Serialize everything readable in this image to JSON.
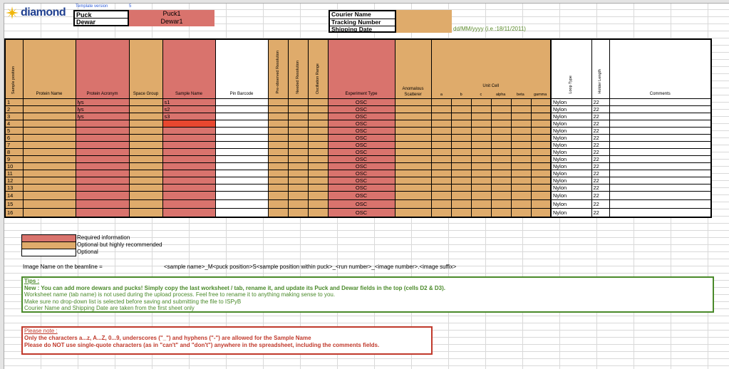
{
  "header": {
    "logo_text": "diamond",
    "template_version_label": "Template version",
    "template_version_value": "5",
    "puck_label": "Puck",
    "dewar_label": "Dewar",
    "puck_value": "Puck1",
    "dewar_value": "Dewar1",
    "courier_name_label": "Courier Name",
    "tracking_number_label": "Tracking Number",
    "shipping_date_label": "Shipping Date",
    "date_hint": "dd/MM/yyyy (i.e.:18/11/2011)"
  },
  "table": {
    "headers": {
      "sample_position": "Sample position",
      "protein_name": "Protein Name",
      "protein_acronym": "Protein Acronym",
      "space_group": "Space Group",
      "sample_name": "Sample Name",
      "pin_barcode": "Pin Barcode",
      "pre_observed_resolution": "Pre-observed Resolution",
      "needed_resolution": "Needed Resolution",
      "oscillation_range": "Oscillation Range",
      "experiment_type": "Experiment Type",
      "anomalous_scatterer": "Anomalous Scatterer",
      "unit_cell": "Unit Cell",
      "uc_a": "a",
      "uc_b": "b",
      "uc_c": "c",
      "uc_alpha": "alpha",
      "uc_beta": "beta",
      "uc_gamma": "gamma",
      "loop_type": "Loop Type",
      "holder_length": "Holder Length",
      "comments": "Comments"
    },
    "rows": [
      {
        "pos": "1",
        "acronym": "lys",
        "sample": "s1",
        "exp": "OSC",
        "loop": "Nylon",
        "holder": "22"
      },
      {
        "pos": "2",
        "acronym": "lys",
        "sample": "s2",
        "exp": "OSC",
        "loop": "Nylon",
        "holder": "22"
      },
      {
        "pos": "3",
        "acronym": "lys",
        "sample": "s3",
        "exp": "OSC",
        "loop": "Nylon",
        "holder": "22"
      },
      {
        "pos": "4",
        "acronym": "",
        "sample": "",
        "exp": "OSC",
        "loop": "Nylon",
        "holder": "22"
      },
      {
        "pos": "5",
        "acronym": "",
        "sample": "",
        "exp": "OSC",
        "loop": "Nylon",
        "holder": "22"
      },
      {
        "pos": "6",
        "acronym": "",
        "sample": "",
        "exp": "OSC",
        "loop": "Nylon",
        "holder": "22"
      },
      {
        "pos": "7",
        "acronym": "",
        "sample": "",
        "exp": "OSC",
        "loop": "Nylon",
        "holder": "22"
      },
      {
        "pos": "8",
        "acronym": "",
        "sample": "",
        "exp": "OSC",
        "loop": "Nylon",
        "holder": "22"
      },
      {
        "pos": "9",
        "acronym": "",
        "sample": "",
        "exp": "OSC",
        "loop": "Nylon",
        "holder": "22"
      },
      {
        "pos": "10",
        "acronym": "",
        "sample": "",
        "exp": "OSC",
        "loop": "Nylon",
        "holder": "22"
      },
      {
        "pos": "11",
        "acronym": "",
        "sample": "",
        "exp": "OSC",
        "loop": "Nylon",
        "holder": "22"
      },
      {
        "pos": "12",
        "acronym": "",
        "sample": "",
        "exp": "OSC",
        "loop": "Nylon",
        "holder": "22"
      },
      {
        "pos": "13",
        "acronym": "",
        "sample": "",
        "exp": "OSC",
        "loop": "Nylon",
        "holder": "22"
      },
      {
        "pos": "14",
        "acronym": "",
        "sample": "",
        "exp": "OSC",
        "loop": "Nylon",
        "holder": "22"
      },
      {
        "pos": "15",
        "acronym": "",
        "sample": "",
        "exp": "OSC",
        "loop": "Nylon",
        "holder": "22"
      },
      {
        "pos": "16",
        "acronym": "",
        "sample": "",
        "exp": "OSC",
        "loop": "Nylon",
        "holder": "22"
      }
    ]
  },
  "legend": {
    "required": "Required information",
    "optional_recommended": "Optional but highly recommended",
    "optional": "Optional"
  },
  "image_name": {
    "label": "Image Name on the beamline =",
    "pattern": "<sample name>_M<puck position>S<sample position within puck>_<run number>_<image number>.<image suffix>"
  },
  "tips": {
    "title": "Tips :",
    "line1": "New : You can add more dewars and pucks! Simply copy the last worksheet / tab, rename it, and update its Puck and Dewar fields in the top (cells D2 & D3).",
    "line2": "Worksheet name (tab name) is not used during the upload process. Feel free to rename it to anything making sense to you.",
    "line3": "Make sure no drop-down list is selected before saving and submitting the file to ISPyB",
    "line4": "Courier Name and Shipping Date are taken from the first sheet only"
  },
  "note": {
    "title": "Please note :",
    "line1": "Only the characters a...z, A...Z, 0...9, underscores (\"_\") and hyphens (\"-\") are allowed for the Sample Name",
    "line2": "Please do NOT use single-quote characters (as in \"can't\" and \"don't\") anywhere in the spreadsheet, including the comments fields."
  },
  "colors": {
    "required": "#d9736d",
    "optional_recommended": "#dfab6b",
    "optional": "#ffffff",
    "tips_border": "#4a8a2a",
    "note_border": "#c0392b",
    "highlight_cell": "#e8472f"
  }
}
